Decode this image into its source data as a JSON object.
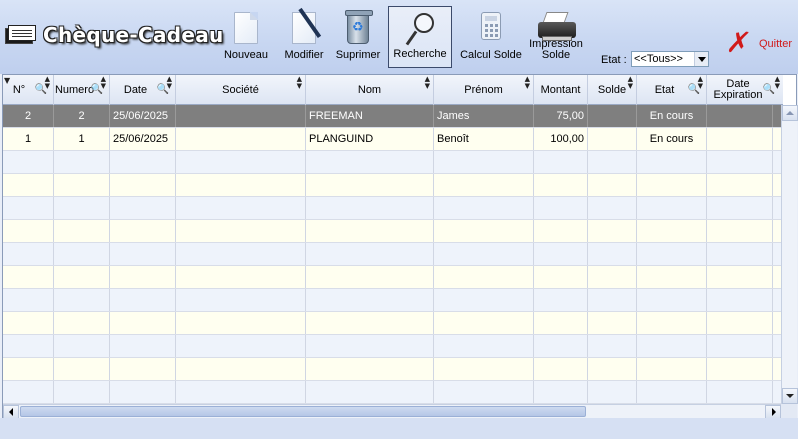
{
  "app": {
    "title": "Chèque-Cadeau"
  },
  "toolbar": {
    "nouveau": "Nouveau",
    "modifier": "Modifier",
    "supprimer": "Suprimer",
    "recherche": "Recherche",
    "calcul": "Calcul Solde",
    "impression_line1": "Impression",
    "impression_line2": "Solde",
    "etat_label": "Etat :",
    "etat_value": "<<Tous>>",
    "quitter": "Quitter"
  },
  "table": {
    "columns": {
      "n": "N°",
      "numero": "Numero",
      "date": "Date",
      "societe": "Société",
      "nom": "Nom",
      "prenom": "Prénom",
      "montant": "Montant",
      "solde": "Solde",
      "etat": "Etat",
      "date_exp_1": "Date",
      "date_exp_2": "Expiration"
    },
    "rows": [
      {
        "n": "2",
        "numero": "2",
        "date": "25/06/2025",
        "societe": "",
        "nom": "FREEMAN",
        "prenom": "James",
        "montant": "75,00",
        "solde": "",
        "etat": "En cours",
        "date_exp": ""
      },
      {
        "n": "1",
        "numero": "1",
        "date": "25/06/2025",
        "societe": "",
        "nom": "PLANGUIND",
        "prenom": "Benoît",
        "montant": "100,00",
        "solde": "",
        "etat": "En cours",
        "date_exp": ""
      }
    ]
  }
}
